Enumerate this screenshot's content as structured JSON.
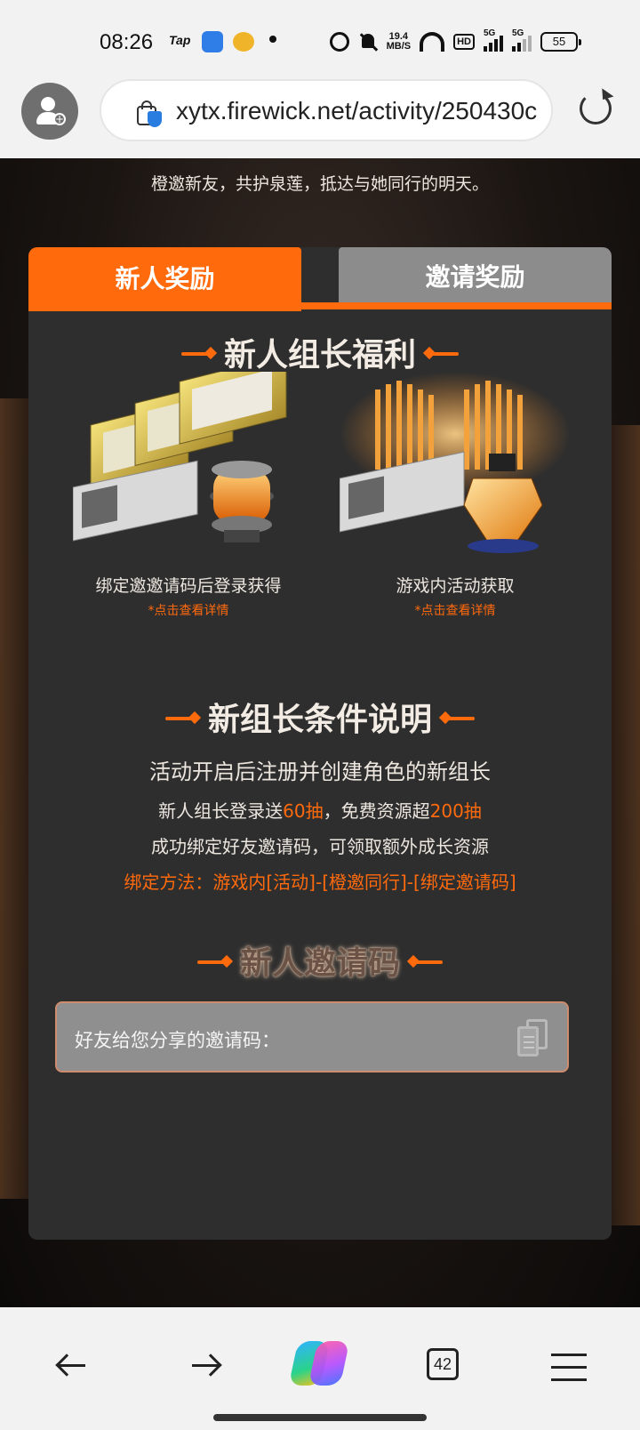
{
  "status_bar": {
    "time": "08:26",
    "tap_label": "Tap",
    "speed_top": "19.4",
    "speed_bottom": "MB/S",
    "hd_label": "HD",
    "sig1_label": "5G",
    "sig2_label": "5G",
    "battery": "55"
  },
  "browser": {
    "url": "xytx.firewick.net/activity/250430c",
    "tab_count": "42"
  },
  "page": {
    "subtitle": "橙邀新友，共护泉莲，抵达与她同行的明天。",
    "tabs": {
      "new_reward": "新人奖励",
      "invite_reward": "邀请奖励"
    },
    "welfare_title": "新人组长福利",
    "rewards": [
      {
        "caption": "绑定邀邀请码后登录获得",
        "detail": "*点击查看详情"
      },
      {
        "caption": "游戏内活动获取",
        "detail": "*点击查看详情"
      }
    ],
    "conditions_title": "新组长条件说明",
    "conditions": {
      "line1": "活动开启后注册并创建角色的新组长",
      "line2_a": "新人组长登录送",
      "line2_b": "60抽",
      "line2_c": "，免费资源超",
      "line2_d": "200抽",
      "line3": "成功绑定好友邀请码，可领取额外成长资源",
      "line4": "绑定方法：游戏内[活动]-[橙邀同行]-[绑定邀请码]"
    },
    "code_title": "新人邀请码",
    "code_label": "好友给您分享的邀请码："
  },
  "colors": {
    "accent": "#ff6a0d",
    "card": "#2e2e2e",
    "inactive_tab": "#8c8c8c"
  }
}
